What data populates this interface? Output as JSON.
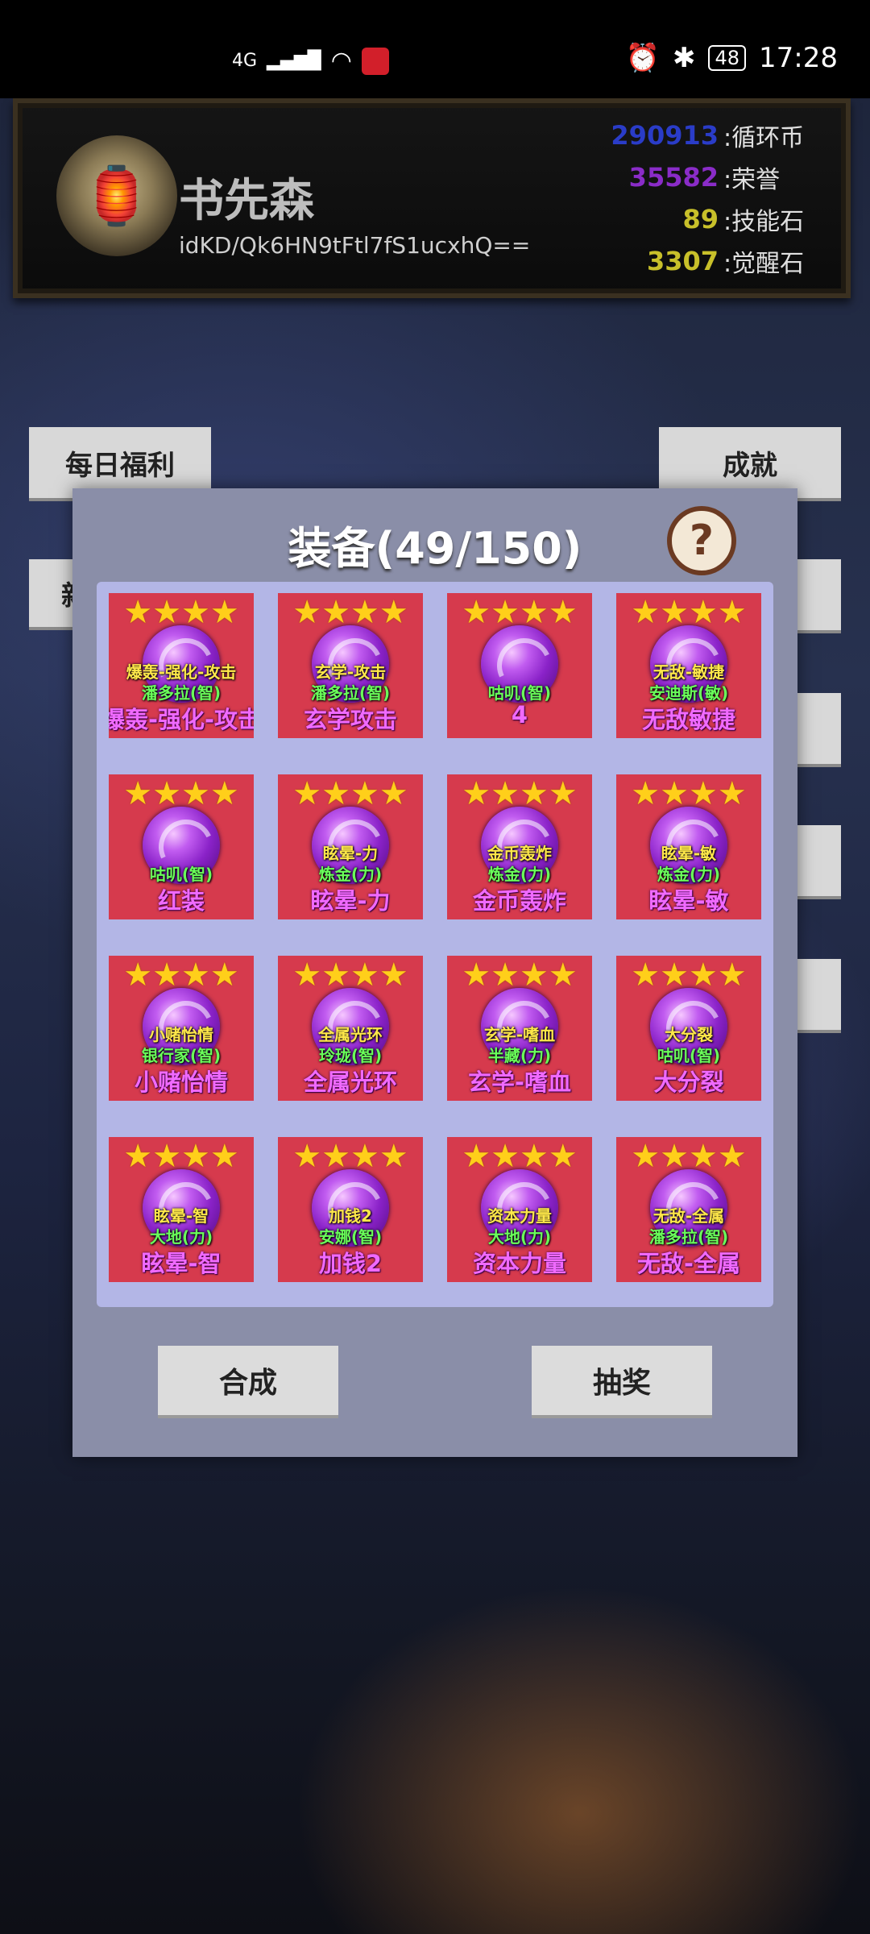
{
  "status_bar": {
    "network": "4G",
    "battery": "48",
    "time": "17:28"
  },
  "profile": {
    "name": "书先森",
    "id": "idKD/Qk6HN9tFtl7fS1ucxhQ==",
    "currencies": [
      {
        "value": "290913",
        "label": ":循环币",
        "color": "#2a3cc8"
      },
      {
        "value": "35582",
        "label": ":荣誉",
        "color": "#8a2cc8"
      },
      {
        "value": "89",
        "label": ":技能石",
        "color": "#c8c02a"
      },
      {
        "value": "3307",
        "label": ":觉醒石",
        "color": "#c8c02a"
      }
    ]
  },
  "side_buttons": {
    "daily": "每日福利",
    "achievement": "成就",
    "left_partial": "新"
  },
  "modal": {
    "title": "装备(49/150)",
    "help": "?",
    "merge_button": "合成",
    "lottery_button": "抽奖"
  },
  "equipment": [
    {
      "l1": "爆轰-强化-攻击",
      "l2": "潘多拉(智)",
      "l3": "爆轰-强化-攻击"
    },
    {
      "l1": "玄学-攻击",
      "l2": "潘多拉(智)",
      "l3": "玄学攻击"
    },
    {
      "l1": "",
      "l2": "咕叽(智)",
      "l3": "4"
    },
    {
      "l1": "无敌-敏捷",
      "l2": "安迪斯(敏)",
      "l3": "无敌敏捷"
    },
    {
      "l1": "",
      "l2": "咕叽(智)",
      "l3": "红装"
    },
    {
      "l1": "眩晕-力",
      "l2": "炼金(力)",
      "l3": "眩晕-力"
    },
    {
      "l1": "金币轰炸",
      "l2": "炼金(力)",
      "l3": "金币轰炸"
    },
    {
      "l1": "眩晕-敏",
      "l2": "炼金(力)",
      "l3": "眩晕-敏"
    },
    {
      "l1": "小赌怡情",
      "l2": "银行家(智)",
      "l3": "小赌怡情"
    },
    {
      "l1": "全属光环",
      "l2": "玲珑(智)",
      "l3": "全属光环"
    },
    {
      "l1": "玄学-嗜血",
      "l2": "半藏(力)",
      "l3": "玄学-嗜血"
    },
    {
      "l1": "大分裂",
      "l2": "咕叽(智)",
      "l3": "大分裂"
    },
    {
      "l1": "眩晕-智",
      "l2": "大地(力)",
      "l3": "眩晕-智"
    },
    {
      "l1": "加钱2",
      "l2": "安娜(智)",
      "l3": "加钱2"
    },
    {
      "l1": "资本力量",
      "l2": "大地(力)",
      "l3": "资本力量"
    },
    {
      "l1": "无敌-全属",
      "l2": "潘多拉(智)",
      "l3": "无敌-全属"
    }
  ]
}
